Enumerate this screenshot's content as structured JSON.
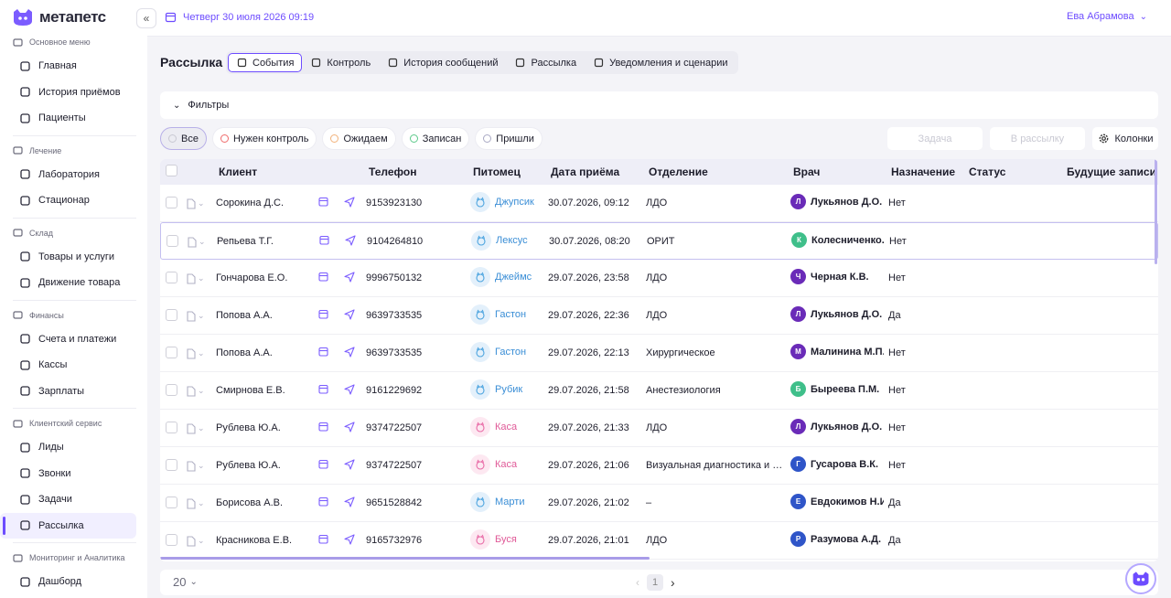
{
  "app": {
    "brand": "метапетс"
  },
  "topbar": {
    "datetime": "Четверг 30 июля 2026 09:19",
    "user_name": "Ева Абрамова"
  },
  "sidebar": {
    "sections": [
      {
        "label": "Основное меню",
        "icon": "monitor-icon",
        "items": [
          {
            "label": "Главная",
            "icon": "home-icon"
          },
          {
            "label": "История приёмов",
            "icon": "calendar-icon"
          },
          {
            "label": "Пациенты",
            "icon": "paw-icon"
          }
        ]
      },
      {
        "label": "Лечение",
        "icon": "heart-icon",
        "items": [
          {
            "label": "Лаборатория",
            "icon": "flask-icon"
          },
          {
            "label": "Стационар",
            "icon": "bed-icon"
          }
        ]
      },
      {
        "label": "Склад",
        "icon": "box-icon",
        "items": [
          {
            "label": "Товары и услуги",
            "icon": "package-icon"
          },
          {
            "label": "Движение товара",
            "icon": "arrows-icon"
          }
        ]
      },
      {
        "label": "Финансы",
        "icon": "chart-icon",
        "items": [
          {
            "label": "Счета и платежи",
            "icon": "grid-icon"
          },
          {
            "label": "Кассы",
            "icon": "register-icon"
          },
          {
            "label": "Зарплаты",
            "icon": "wallet-icon"
          }
        ]
      },
      {
        "label": "Клиентский сервис",
        "icon": "phone-icon",
        "items": [
          {
            "label": "Лиды",
            "icon": "book-icon"
          },
          {
            "label": "Звонки",
            "icon": "call-icon"
          },
          {
            "label": "Задачи",
            "icon": "task-icon"
          },
          {
            "label": "Рассылка",
            "icon": "mail-icon",
            "active": true
          }
        ]
      },
      {
        "label": "Мониторинг и Аналитика",
        "icon": "analytics-icon",
        "items": [
          {
            "label": "Дашборд",
            "icon": "dashboard-icon"
          }
        ]
      }
    ]
  },
  "page": {
    "title": "Рассылка"
  },
  "tabs": [
    {
      "label": "События",
      "icon": "events-icon",
      "active": true
    },
    {
      "label": "Контроль",
      "icon": "bars-icon"
    },
    {
      "label": "История сообщений",
      "icon": "envelope-icon"
    },
    {
      "label": "Рассылка",
      "icon": "send-icon"
    },
    {
      "label": "Уведомления и сценарии",
      "icon": "bell-icon"
    }
  ],
  "filters": {
    "label": "Фильтры"
  },
  "status_chips": [
    {
      "label": "Все",
      "color": "#c9c9d3",
      "active": true
    },
    {
      "label": "Нужен контроль",
      "color": "#ef6b6b"
    },
    {
      "label": "Ожидаем",
      "color": "#f2b27a"
    },
    {
      "label": "Записан",
      "color": "#5cc98a"
    },
    {
      "label": "Пришли",
      "color": "#a9a9c4"
    }
  ],
  "actions": {
    "task": "Задача",
    "to_mailing": "В рассылку",
    "columns": "Колонки"
  },
  "table": {
    "headers": {
      "client": "Клиент",
      "phone": "Телефон",
      "pet": "Питомец",
      "date": "Дата приёма",
      "dept": "Отделение",
      "doctor": "Врач",
      "purpose": "Назначение",
      "status": "Статус",
      "future": "Будущие записи"
    },
    "rows": [
      {
        "client": "Сорокина Д.С.",
        "phone": "9153923130",
        "pet": "Джупсик",
        "pet_type": "cat",
        "date": "30.07.2026, 09:12",
        "dept": "ЛДО",
        "doctor": "Лукьянов Д.О.",
        "doc_initial": "Л",
        "doc_color": "#6a2bb8",
        "purpose": "Нет"
      },
      {
        "client": "Репьева Т.Г.",
        "phone": "9104264810",
        "pet": "Лексус",
        "pet_type": "dog",
        "date": "30.07.2026, 08:20",
        "dept": "ОРИТ",
        "doctor": "Колесниченко...",
        "doc_initial": "К",
        "doc_color": "#3fbf8a",
        "purpose": "Нет"
      },
      {
        "client": "Гончарова Е.О.",
        "phone": "9996750132",
        "pet": "Джеймс",
        "pet_type": "cat",
        "date": "29.07.2026, 23:58",
        "dept": "ЛДО",
        "doctor": "Черная К.В.",
        "doc_initial": "Ч",
        "doc_color": "#6a2bb8",
        "purpose": "Нет"
      },
      {
        "client": "Попова А.А.",
        "phone": "9639733535",
        "pet": "Гастон",
        "pet_type": "dog",
        "date": "29.07.2026, 22:36",
        "dept": "ЛДО",
        "doctor": "Лукьянов Д.О.",
        "doc_initial": "Л",
        "doc_color": "#6a2bb8",
        "purpose": "Да"
      },
      {
        "client": "Попова А.А.",
        "phone": "9639733535",
        "pet": "Гастон",
        "pet_type": "dog",
        "date": "29.07.2026, 22:13",
        "dept": "Хирургическое",
        "doctor": "Малинина М.П.",
        "doc_initial": "М",
        "doc_color": "#6a2bb8",
        "purpose": "Нет"
      },
      {
        "client": "Смирнова Е.В.",
        "phone": "9161229692",
        "pet": "Рубик",
        "pet_type": "cat",
        "date": "29.07.2026, 21:58",
        "dept": "Анестезиология",
        "doctor": "Быреева П.М.",
        "doc_initial": "Б",
        "doc_color": "#3fbf8a",
        "purpose": "Нет"
      },
      {
        "client": "Рублева Ю.А.",
        "phone": "9374722507",
        "pet": "Каса",
        "pet_type": "cat-pink",
        "date": "29.07.2026, 21:33",
        "dept": "ЛДО",
        "doctor": "Лукьянов Д.О.",
        "doc_initial": "Л",
        "doc_color": "#6a2bb8",
        "purpose": "Нет"
      },
      {
        "client": "Рублева Ю.А.",
        "phone": "9374722507",
        "pet": "Каса",
        "pet_type": "cat-pink",
        "date": "29.07.2026, 21:06",
        "dept": "Визуальная диагностика и н...",
        "doctor": "Гусарова В.К.",
        "doc_initial": "Г",
        "doc_color": "#2f55c8",
        "purpose": "Нет"
      },
      {
        "client": "Борисова А.В.",
        "phone": "9651528842",
        "pet": "Марти",
        "pet_type": "dog",
        "date": "29.07.2026, 21:02",
        "dept": "–",
        "doctor": "Евдокимов Н.И.",
        "doc_initial": "Е",
        "doc_color": "#2f55c8",
        "purpose": "Да"
      },
      {
        "client": "Красникова Е.В.",
        "phone": "9165732976",
        "pet": "Буся",
        "pet_type": "cat-pink",
        "date": "29.07.2026, 21:01",
        "dept": "ЛДО",
        "doctor": "Разумова А.Д.",
        "doc_initial": "Р",
        "doc_color": "#2f55c8",
        "purpose": "Да"
      }
    ]
  },
  "pagination": {
    "per_page": "20",
    "current_page": "1"
  }
}
